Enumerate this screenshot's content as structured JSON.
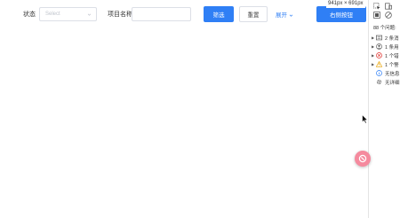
{
  "filters": {
    "status_label": "状态",
    "status_select": {
      "placeholder": "Select"
    },
    "project_label": "项目名称",
    "project_input": {
      "value": ""
    },
    "filter_button": "筛选",
    "reset_button": "重置",
    "expand_link": "展开",
    "right_button": "右侧按钮"
  },
  "inspect_tooltip": "941px × 691px",
  "devtools": {
    "issues_count": "88 个问题:",
    "rows": [
      {
        "label": "2 条消",
        "icon": "message-icon",
        "expandable": true
      },
      {
        "label": "1 条用",
        "icon": "user-icon",
        "expandable": true
      },
      {
        "label": "1 个错",
        "icon": "error-icon",
        "expandable": true
      },
      {
        "label": "1 个警",
        "icon": "warning-icon",
        "expandable": true
      },
      {
        "label": "无信息",
        "icon": "info-icon",
        "expandable": false
      },
      {
        "label": "无详细",
        "icon": "verbose-icon",
        "expandable": false
      }
    ]
  },
  "colors": {
    "primary": "#2f7ff5",
    "error": "#e0332f",
    "warning": "#e8a200",
    "info": "#2f7ff5",
    "floating_button": "#f58a9e"
  }
}
